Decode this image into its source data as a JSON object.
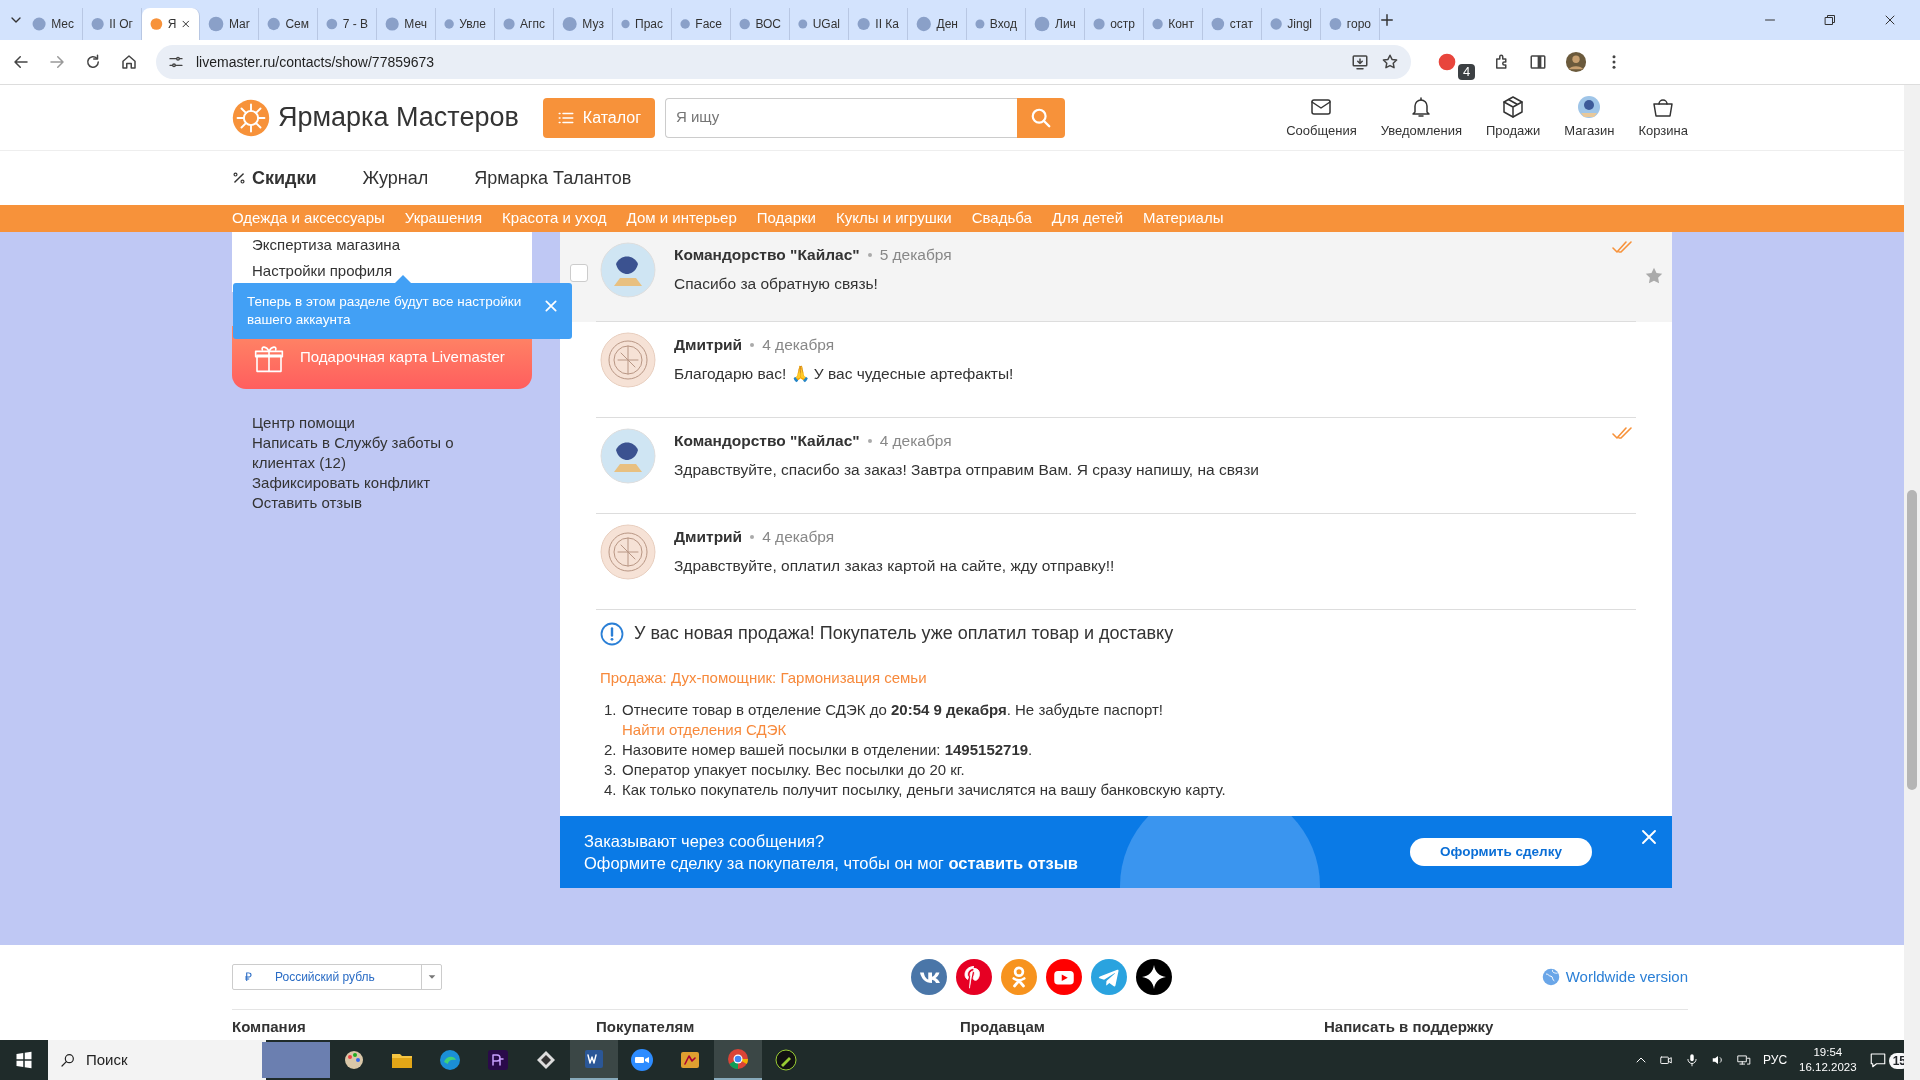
{
  "browser": {
    "tabs": [
      {
        "label": "Мес",
        "selected": false
      },
      {
        "label": "II Ог",
        "selected": false
      },
      {
        "label": "Я",
        "selected": true
      },
      {
        "label": "Мar",
        "selected": false
      },
      {
        "label": "Сем",
        "selected": false
      },
      {
        "label": "7 - В",
        "selected": false
      },
      {
        "label": "Меч",
        "selected": false
      },
      {
        "label": "Увле",
        "selected": false
      },
      {
        "label": "Агпс",
        "selected": false
      },
      {
        "label": "Муз",
        "selected": false
      },
      {
        "label": "Прас",
        "selected": false
      },
      {
        "label": "Face",
        "selected": false
      },
      {
        "label": "ВОС",
        "selected": false
      },
      {
        "label": "UGal",
        "selected": false
      },
      {
        "label": "II Ка",
        "selected": false
      },
      {
        "label": "Ден",
        "selected": false
      },
      {
        "label": "Вход",
        "selected": false
      },
      {
        "label": "Лич",
        "selected": false
      },
      {
        "label": "остр",
        "selected": false
      },
      {
        "label": "Конт",
        "selected": false
      },
      {
        "label": "стат",
        "selected": false
      },
      {
        "label": "Jingl",
        "selected": false
      },
      {
        "label": "горо",
        "selected": false
      }
    ],
    "url": "livemaster.ru/contacts/show/77859673",
    "extension_badge": "4"
  },
  "header": {
    "logo": "Ярмарка Мастеров",
    "catalog": "Каталог",
    "search_placeholder": "Я ищу",
    "actions": [
      {
        "label": "Сообщения",
        "kind": "mail"
      },
      {
        "label": "Уведомления",
        "kind": "bell"
      },
      {
        "label": "Продажи",
        "kind": "box"
      },
      {
        "label": "Магазин",
        "kind": "shop"
      },
      {
        "label": "Корзина",
        "kind": "basket"
      }
    ]
  },
  "nav": [
    {
      "label": "Скидки",
      "kind": "discount"
    },
    {
      "label": "Журнал",
      "kind": "link"
    },
    {
      "label": "Ярмарка Талантов",
      "kind": "link"
    }
  ],
  "categories": [
    "Одежда и аксессуары",
    "Украшения",
    "Красота и уход",
    "Дом и интерьер",
    "Подарки",
    "Куклы и игрушки",
    "Свадьба",
    "Для детей",
    "Материалы"
  ],
  "sidebar": {
    "menu": [
      "Экспертиза магазина",
      "Настройки профиля"
    ],
    "tooltip": "Теперь в этом разделе будут все настройки вашего аккаунта",
    "gift_card": "Подарочная карта Livemaster",
    "help": [
      "Центр помощи",
      "Написать в Службу заботы о клиентах (12)",
      "Зафиксировать конфликт",
      "Оставить отзыв"
    ]
  },
  "messages": [
    {
      "author": "Командорство \"Кайлас\"",
      "date": "5 декабря",
      "text": "Спасибо за обратную связь!",
      "kind": "outgoing",
      "read_mark": true,
      "hovered": true
    },
    {
      "author": "Дмитрий",
      "date": "4 декабря",
      "text": "Благодарю вас! 🙏 У вас чудесные артефакты!",
      "kind": "incoming",
      "read_mark": false,
      "hovered": false
    },
    {
      "author": "Командорство \"Кайлас\"",
      "date": "4 декабря",
      "text": "Здравствуйте, спасибо за заказ! Завтра отправим Вам. Я сразу напишу, на связи",
      "kind": "outgoing",
      "read_mark": true,
      "hovered": false
    },
    {
      "author": "Дмитрий",
      "date": "4 декабря",
      "text": "Здравствуйте, оплатил заказ картой на сайте, жду отправку!!",
      "kind": "incoming",
      "read_mark": false,
      "hovered": false
    }
  ],
  "notice": {
    "title": "У вас новая продажа! Покупатель уже оплатил товар и доставку",
    "sale": "Продажа: Дух-помощник: Гармонизация семьи",
    "steps": [
      {
        "number": "1.",
        "text": "Отнесите товар в отделение СДЭК до **20:54 9 декабря**. Не забудьте паспорт!",
        "link": "Найти отделения СДЭК"
      },
      {
        "number": "2.",
        "text": "Назовите номер вашей посылки в отделении: **1495152719**."
      },
      {
        "number": "3.",
        "text": "Оператор упакует посылку. Вес посылки до 20 кг."
      },
      {
        "number": "4.",
        "text": "Как только покупатель получит посылку, деньги зачислятся на вашу банковскую карту."
      }
    ]
  },
  "banner": {
    "title": "Заказывают через сообщения?",
    "text": "Оформите сделку за покупателя, чтобы он мог **оставить отзыв**",
    "button": "Оформить сделку"
  },
  "footer": {
    "currency_symbol": "₽",
    "currency": "Российский рубль",
    "worldwide": "Worldwide version",
    "columns": [
      "Компания",
      "Покупателям",
      "Продавцам",
      "Написать в поддержку"
    ]
  },
  "taskbar": {
    "search": "Поиск",
    "language": "РУС",
    "time": "19:54",
    "date": "16.12.2023",
    "notifications": "15"
  }
}
